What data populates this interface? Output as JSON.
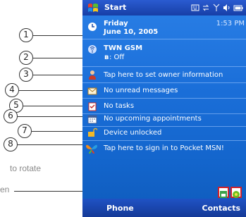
{
  "callouts": [
    "1",
    "2",
    "3",
    "4",
    "5",
    "6",
    "7",
    "8"
  ],
  "side_notes": {
    "line1": "to rotate",
    "line2": "en"
  },
  "titlebar": {
    "title": "Start"
  },
  "today": {
    "day": "Friday",
    "date": "June 10, 2005",
    "time": "1:53 PM",
    "carrier": "TWN GSM",
    "bluetooth": ": Off",
    "owner": "Tap here to set owner information",
    "messages": "No unread messages",
    "tasks": "No tasks",
    "appointments": "No upcoming appointments",
    "lock": "Device unlocked",
    "msn": "Tap here to sign in to Pocket MSN!"
  },
  "softkeys": {
    "left": "Phone",
    "right": "Contacts"
  },
  "colors": {
    "screen_bg": "#1b6fd9",
    "titlebar": "#173fa6",
    "highlight_box": "#d0202a"
  }
}
